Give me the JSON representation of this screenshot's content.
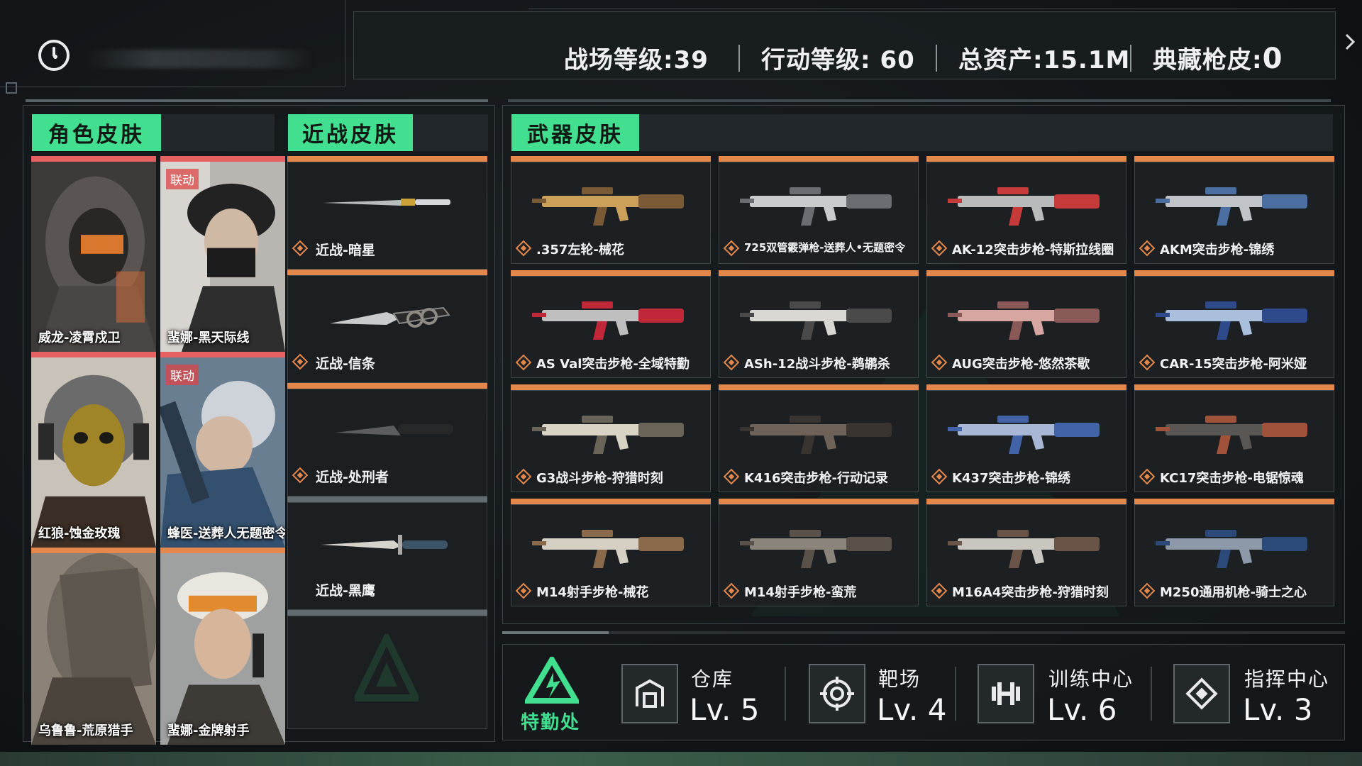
{
  "stats": {
    "battlefield_label": "战场等级:",
    "battlefield_value": "39",
    "operation_label": "行动等级: ",
    "operation_value": "60",
    "assets_label": "总资产:",
    "assets_value": "15.1M",
    "collection_label": "典藏枪皮:",
    "collection_value": "0"
  },
  "tabs": {
    "character": "角色皮肤",
    "melee": "近战皮肤",
    "weapon": "武器皮肤"
  },
  "characters": [
    {
      "label": "威龙-凌霄戍卫",
      "collab": ""
    },
    {
      "label": "蜚娜-黑天际线",
      "collab": "联动"
    },
    {
      "label": "红狼-蚀金玫瑰",
      "collab": ""
    },
    {
      "label": "蜂医-送葬人无题密令",
      "collab": "联动"
    },
    {
      "label": "乌鲁鲁-荒原猎手",
      "collab": ""
    },
    {
      "label": "蜚娜-金牌射手",
      "collab": ""
    }
  ],
  "melee": [
    {
      "label": "近战-暗星"
    },
    {
      "label": "近战-信条"
    },
    {
      "label": "近战-处刑者"
    },
    {
      "label": "近战-黑鹰"
    }
  ],
  "weapons": [
    {
      "label": ".357左轮-械花"
    },
    {
      "label": "725双管霰弹枪-送葬人•无题密令"
    },
    {
      "label": "AK-12突击步枪-特斯拉线圈"
    },
    {
      "label": "AKM突击步枪-锦绣"
    },
    {
      "label": "AS Val突击步枪-全域特勤"
    },
    {
      "label": "ASh-12战斗步枪-鹈鹕杀"
    },
    {
      "label": "AUG突击步枪-悠然茶歇"
    },
    {
      "label": "CAR-15突击步枪-阿米娅"
    },
    {
      "label": "G3战斗步枪-狩猎时刻"
    },
    {
      "label": "K416突击步枪-行动记录"
    },
    {
      "label": "K437突击步枪-锦绣"
    },
    {
      "label": "KC17突击步枪-电锯惊魂"
    },
    {
      "label": "M14射手步枪-械花"
    },
    {
      "label": "M14射手步枪-蛮荒"
    },
    {
      "label": "M16A4突击步枪-狩猎时刻"
    },
    {
      "label": "M250通用机枪-骑士之心"
    }
  ],
  "base": {
    "logistics_label": "特勤处",
    "facilities": [
      {
        "name": "仓库",
        "level": "Lv. 5",
        "icon": "warehouse-icon"
      },
      {
        "name": "靶场",
        "level": "Lv. 4",
        "icon": "target-icon"
      },
      {
        "name": "训练中心",
        "level": "Lv. 6",
        "icon": "dumbbell-icon"
      },
      {
        "name": "指挥中心",
        "level": "Lv. 3",
        "icon": "command-icon"
      }
    ]
  },
  "colors": {
    "accent_green": "#41df8f",
    "rarity_orange": "#e4874b",
    "collab_red": "#e66161"
  }
}
